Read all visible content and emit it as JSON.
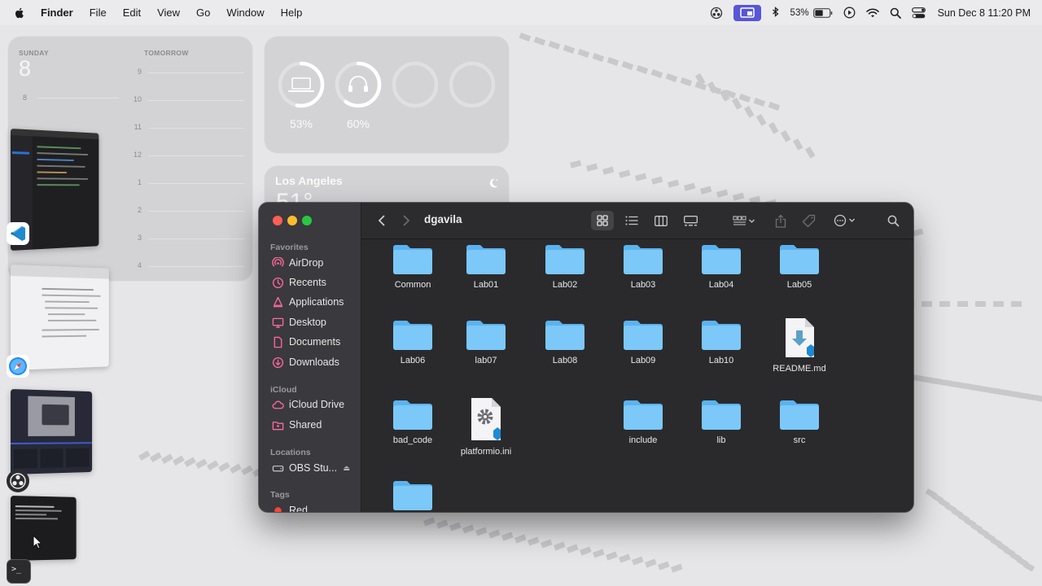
{
  "menubar": {
    "app_name": "Finder",
    "menus": [
      "File",
      "Edit",
      "View",
      "Go",
      "Window",
      "Help"
    ],
    "battery_percent_text": "53%",
    "datetime": "Sun Dec 8  11:20 PM"
  },
  "calendar_widget": {
    "today_label": "SUNDAY",
    "today_date": "8",
    "tomorrow_label": "TOMORROW",
    "today_hours": [
      "8"
    ],
    "tomorrow_hours": [
      "9",
      "10",
      "11",
      "12",
      "1",
      "2",
      "3",
      "4"
    ]
  },
  "battery_widget": {
    "devices": [
      {
        "icon": "laptop-icon",
        "percent_text": "53%",
        "level": 0.53
      },
      {
        "icon": "headphones-icon",
        "percent_text": "60%",
        "level": 0.6
      },
      {
        "icon": "empty-slot",
        "percent_text": "",
        "level": 0
      },
      {
        "icon": "empty-slot",
        "percent_text": "",
        "level": 0
      }
    ]
  },
  "weather_widget": {
    "city": "Los Angeles",
    "temperature_partial": "51°",
    "condition_icon": "moon-icon"
  },
  "stage_manager": {
    "apps": [
      "vscode-icon",
      "safari-icon",
      "obs-icon",
      "terminal-icon"
    ]
  },
  "finder": {
    "folder_title": "dgavila",
    "sidebar": {
      "favorites_label": "Favorites",
      "favorites": [
        {
          "label": "AirDrop",
          "icon": "airdrop-icon"
        },
        {
          "label": "Recents",
          "icon": "clock-icon"
        },
        {
          "label": "Applications",
          "icon": "applications-icon"
        },
        {
          "label": "Desktop",
          "icon": "desktop-icon"
        },
        {
          "label": "Documents",
          "icon": "document-icon"
        },
        {
          "label": "Downloads",
          "icon": "download-icon"
        }
      ],
      "icloud_label": "iCloud",
      "icloud": [
        {
          "label": "iCloud Drive",
          "icon": "cloud-icon"
        },
        {
          "label": "Shared",
          "icon": "shared-folder-icon"
        }
      ],
      "locations_label": "Locations",
      "locations": [
        {
          "label": "OBS Stu...",
          "icon": "disk-icon",
          "eject": "⏏"
        }
      ],
      "tags_label": "Tags",
      "tags": [
        {
          "label": "Red",
          "color": "#ff453a"
        }
      ]
    },
    "files": [
      {
        "name": "Common",
        "kind": "folder"
      },
      {
        "name": "Lab01",
        "kind": "folder"
      },
      {
        "name": "Lab02",
        "kind": "folder"
      },
      {
        "name": "Lab03",
        "kind": "folder"
      },
      {
        "name": "Lab04",
        "kind": "folder"
      },
      {
        "name": "Lab05",
        "kind": "folder"
      },
      {
        "name": "Lab06",
        "kind": "folder"
      },
      {
        "name": "lab07",
        "kind": "folder"
      },
      {
        "name": "Lab08",
        "kind": "folder"
      },
      {
        "name": "Lab09",
        "kind": "folder"
      },
      {
        "name": "Lab10",
        "kind": "folder"
      },
      {
        "name": "README.md",
        "kind": "markdown-file"
      },
      {
        "name": "bad_code",
        "kind": "folder"
      },
      {
        "name": "platformio.ini",
        "kind": "settings-file"
      },
      {
        "name": "include",
        "kind": "folder"
      },
      {
        "name": "lib",
        "kind": "folder"
      },
      {
        "name": "src",
        "kind": "folder"
      },
      {
        "name": "",
        "kind": "folder"
      }
    ],
    "colors": {
      "folder_light": "#7cc8f8",
      "folder_dark": "#5ab3ef",
      "window_bg": "#2a2a2c",
      "sidebar_bg": "#3a393d",
      "accent_pink": "#ff6b9a"
    }
  }
}
